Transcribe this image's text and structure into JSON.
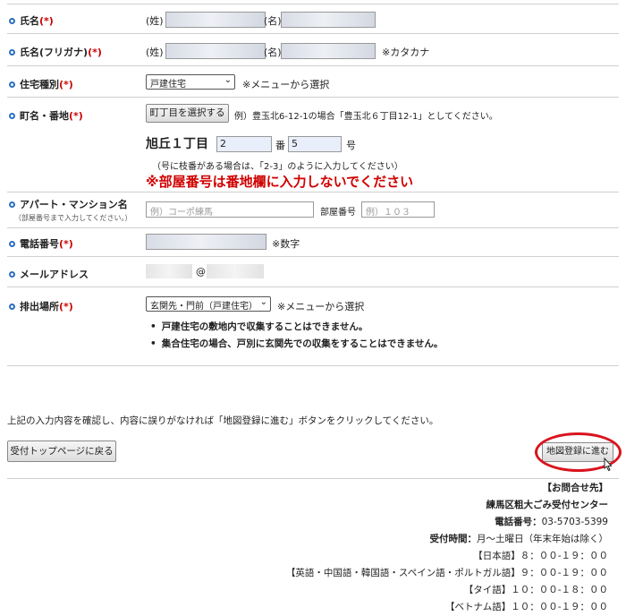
{
  "form": {
    "name": {
      "label": "氏名",
      "req": "(*)",
      "sei": "(姓)",
      "mei": "(名)"
    },
    "kana": {
      "label": "氏名(フリガナ)",
      "req": "(*)",
      "sei": "(姓)",
      "mei": "(名)",
      "note": "※カタカナ"
    },
    "housing": {
      "label": "住宅種別",
      "req": "(*)",
      "selected": "戸建住宅",
      "note": "※メニューから選択"
    },
    "address": {
      "label": "町名・番地",
      "req": "(*)",
      "button": "町丁目を選択する",
      "example": "例）豊玉北6-12-1の場合「豊玉北６丁目12-1」としてください。",
      "town": "旭丘１丁目",
      "ban_value": "2",
      "ban_label": "番",
      "go_value": "5",
      "go_label": "号",
      "hint": "（号に枝番がある場合は、「2-3」のように入力してください）",
      "warning": "※部屋番号は番地欄に入力しないでください"
    },
    "apartment": {
      "label": "アパート・マンション名",
      "sublabel": "（部屋番号まで入力してください。）",
      "placeholder": "例）コーポ練馬",
      "room_label": "部屋番号",
      "room_placeholder": "例）１０３"
    },
    "phone": {
      "label": "電話番号",
      "req": "(*)",
      "note": "※数字"
    },
    "email": {
      "label": "メールアドレス",
      "at": "@"
    },
    "location": {
      "label": "排出場所",
      "req": "(*)",
      "selected": "玄関先・門前（戸建住宅）",
      "note": "※メニューから選択",
      "notes": [
        "戸建住宅の敷地内で収集することはできません。",
        "集合住宅の場合、戸別に玄関先での収集をすることはできません。"
      ]
    }
  },
  "instruction": "上記の入力内容を確認し、内容に誤りがなければ「地図登録に進む」ボタンをクリックしてください。",
  "buttons": {
    "back": "受付トップページに戻る",
    "next": "地図登録に進む"
  },
  "contact": {
    "heading": "【お問合せ先】",
    "center": "練馬区粗大ごみ受付センター",
    "phone_label": "電話番号：",
    "phone": "03-5703-5399",
    "hours_label": "受付時間：",
    "hours": "月～土曜日（年末年始は除く）",
    "lines": [
      "【日本語】８：００-１９：００",
      "【英語・中国語・韓国語・スペイン語・ポルトガル語】９：００-１９：００",
      "【タイ語】１０：００-１８：００",
      "【ベトナム語】１０：００-１９：００"
    ]
  },
  "colors": {
    "required": "#cc0000",
    "warning": "#d00000",
    "bullet_icon": "#2a6fc0",
    "highlight_ellipse": "#d9141e",
    "input_bg": "#e8effa"
  }
}
